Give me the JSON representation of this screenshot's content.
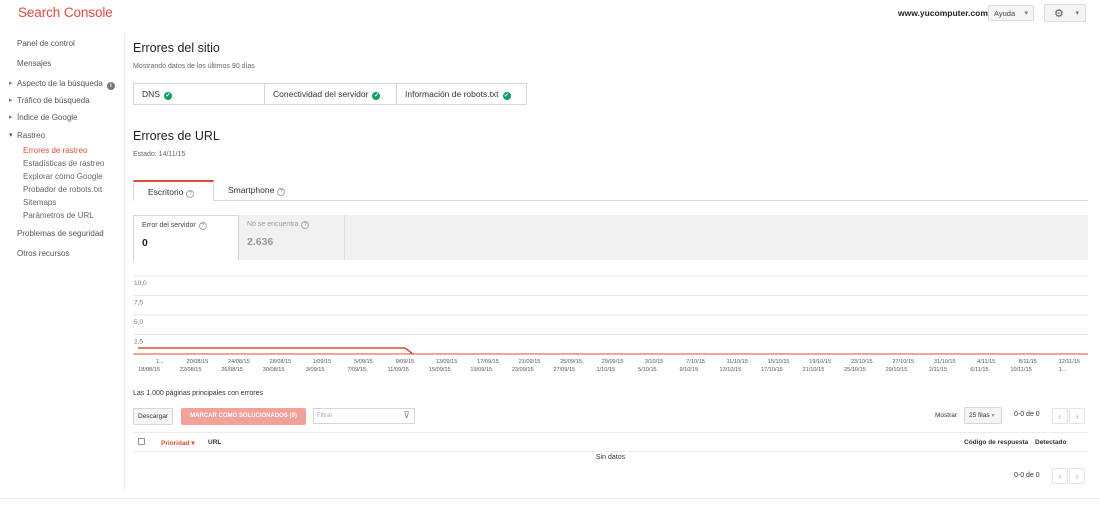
{
  "header": {
    "logo": "Search Console",
    "site": "www.yucomputer.com",
    "help_label": "Ayuda",
    "help_caret": "▾",
    "gear_icon": "⚙",
    "settings_caret": "▾"
  },
  "sidebar": {
    "items": [
      {
        "label": "Panel de control"
      },
      {
        "label": "Mensajes"
      },
      {
        "label": "Aspecto de la búsqueda"
      },
      {
        "label": "Tráfico de búsqueda"
      },
      {
        "label": "Índice de Google"
      },
      {
        "label": "Rastreo"
      },
      {
        "label": "Problemas de seguridad"
      },
      {
        "label": "Otros recursos"
      }
    ],
    "info_glyph": "i",
    "crawl_sub": [
      {
        "label": "Errores de rastreo"
      },
      {
        "label": "Estadísticas de rastreo"
      },
      {
        "label": "Explorar como Google"
      },
      {
        "label": "Probador de robots.txt"
      },
      {
        "label": "Sitemaps"
      },
      {
        "label": "Parámetros de URL"
      }
    ]
  },
  "site_errors": {
    "title": "Errores del sitio",
    "subtitle": "Mostrando datos de los últimos 90 días",
    "checks": [
      {
        "label": "DNS",
        "status": "ok"
      },
      {
        "label": "Conectividad del servidor",
        "status": "ok"
      },
      {
        "label": "Información de robots.txt",
        "status": "ok"
      }
    ],
    "ok_glyph": "✔"
  },
  "url_errors": {
    "title": "Errores de URL",
    "state": "Estado: 14/11/15",
    "tabs": [
      {
        "label": "Escritorio",
        "active": true
      },
      {
        "label": "Smartphone",
        "active": false
      }
    ],
    "help_glyph": "?",
    "metrics": [
      {
        "label": "Error del servidor",
        "value": "0",
        "selected": true
      },
      {
        "label": "No se encuentra",
        "value": "2.636",
        "selected": false
      }
    ]
  },
  "chart_data": {
    "type": "line",
    "series": [
      {
        "values_note": "",
        "x_start": "18/08/15",
        "x_end": "09/09/15",
        "y": 0
      }
    ],
    "ylim": [
      0,
      10
    ],
    "y_ticks": [
      "10,0",
      "7,5",
      "5,0",
      "2,5"
    ],
    "x_ticks_top": [
      "1...",
      "20/08/15",
      "24/08/15",
      "28/08/15",
      "1/09/15",
      "5/09/15",
      "9/09/15",
      "13/09/15",
      "17/09/15",
      "21/09/15",
      "25/09/15",
      "29/09/15",
      "3/10/15",
      "7/10/15",
      "11/10/15",
      "15/10/15",
      "19/10/15",
      "23/10/15",
      "27/10/15",
      "31/10/15",
      "4/11/15",
      "8/11/15",
      "12/11/15"
    ],
    "x_ticks_bottom": [
      "18/08/15",
      "22/08/15",
      "26/08/15",
      "30/08/15",
      "3/09/15",
      "7/09/15",
      "11/09/15",
      "15/09/15",
      "19/09/15",
      "23/09/15",
      "27/09/15",
      "1/10/15",
      "5/10/15",
      "9/10/15",
      "13/10/15",
      "17/10/15",
      "21/10/15",
      "25/10/15",
      "29/10/15",
      "2/11/15",
      "6/11/15",
      "10/11/15",
      "1..."
    ],
    "line_color": "#dd4b39",
    "grid": true
  },
  "table": {
    "top_label": "Las 1.000 páginas principales con errores",
    "download": "Descargar",
    "mark_fixed": "MARCAR COMO SOLUCIONADOS (0)",
    "filter_placeholder": "Filtrar",
    "filter_icon": "⊽",
    "show_label": "Mostrar",
    "rows_select": "25 filas",
    "rows_caret": "▾",
    "range": "0-0 de 0",
    "prev": "‹",
    "next": "›",
    "columns": {
      "priority": "Prioridad",
      "priority_caret": "▾",
      "url": "URL",
      "response_code": "Código de respuesta",
      "detected": "Detectado"
    },
    "empty_text": "Sin datos"
  }
}
